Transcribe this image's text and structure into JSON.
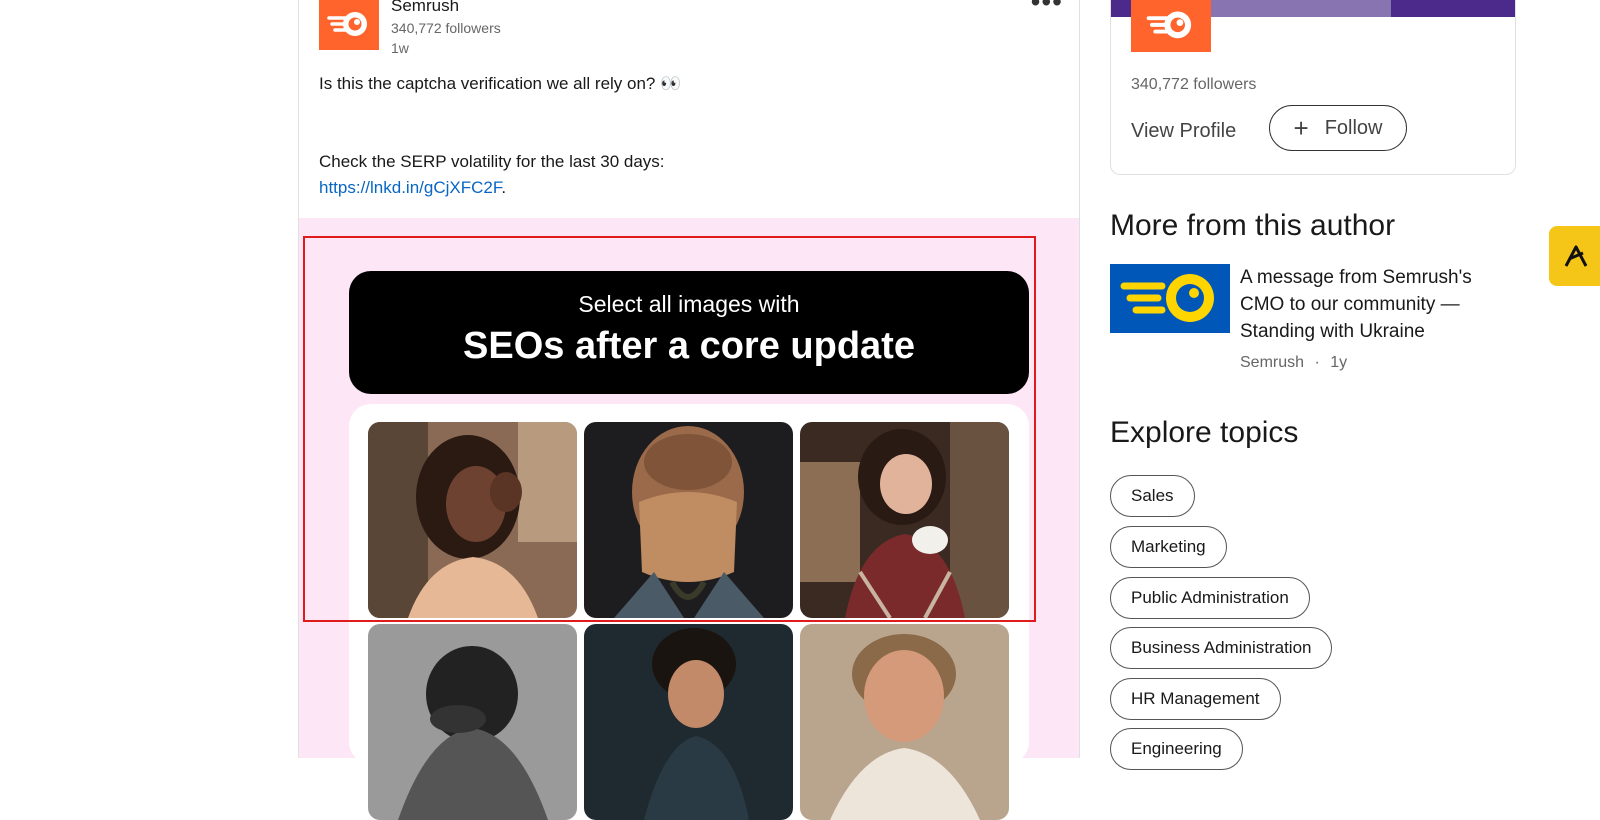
{
  "post": {
    "author_name": "Semrush",
    "author_followers": "340,772 followers",
    "time": "1w",
    "more_icon": "more-horizontal-icon",
    "text_line1": "Is this the captcha verification we all rely on? 👀",
    "text_line2": "Check the SERP volatility for the last 30 days:",
    "link_text": "https://lnkd.in/gCjXFC2F",
    "link_suffix": ".",
    "image": {
      "captcha_small": "Select all images with",
      "captcha_big": "SEOs after a core update"
    }
  },
  "profile_card": {
    "followers": "340,772 followers",
    "view_profile": "View Profile",
    "follow_label": "Follow",
    "follow_icon": "plus-icon"
  },
  "more_from_author": {
    "title": "More from this author",
    "article_title": "A message from Semrush's CMO to our community — Standing with Ukraine",
    "article_author": "Semrush",
    "article_sep": "·",
    "article_time": "1y"
  },
  "explore": {
    "title": "Explore topics",
    "topics": [
      "Sales",
      "Marketing",
      "Public Administration",
      "Business Administration",
      "HR Management",
      "Engineering"
    ]
  },
  "colors": {
    "brand_orange": "#ff642d",
    "link_blue": "#0a66c2",
    "pink_bg": "#fde6f6",
    "highlight_red": "#e01b1b",
    "widget_yellow": "#f5c518"
  }
}
